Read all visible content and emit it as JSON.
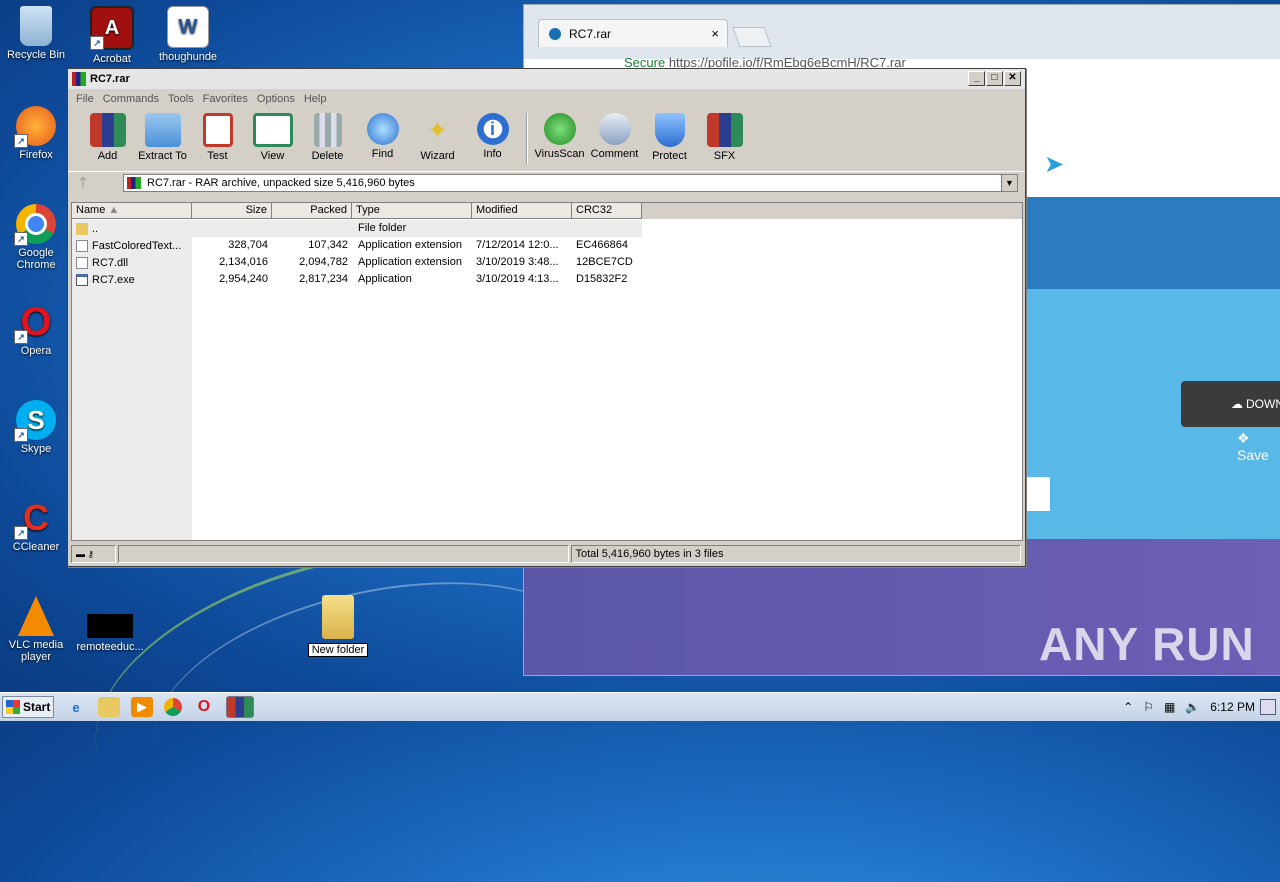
{
  "desktop": {
    "icons": [
      {
        "label": "Recycle Bin",
        "icon": "recycle-bin-icon"
      },
      {
        "label": "Acrobat",
        "icon": "acrobat-icon"
      },
      {
        "label": "thoughunde",
        "icon": "word-document-icon"
      },
      {
        "label": "Firefox",
        "icon": "firefox-icon"
      },
      {
        "label": "Google Chrome",
        "icon": "chrome-icon"
      },
      {
        "label": "Opera",
        "icon": "opera-icon"
      },
      {
        "label": "Skype",
        "icon": "skype-icon"
      },
      {
        "label": "CCleaner",
        "icon": "ccleaner-icon"
      },
      {
        "label": "VLC media player",
        "icon": "vlc-icon"
      },
      {
        "label": "remoteeduc...",
        "icon": "black-file-icon"
      }
    ],
    "new_folder_label": "New folder"
  },
  "browser": {
    "tab_title": "RC7.rar",
    "tab_close": "×",
    "address_secure": "Secure",
    "address_url": "https://pofile.io/f/RmEbq6eBcmH/RC7.rar",
    "download_label": "DOWN",
    "save_label": "Save",
    "watermark": "ANY RUN"
  },
  "winrar": {
    "title": "RC7.rar",
    "menu": [
      "File",
      "Commands",
      "Tools",
      "Favorites",
      "Options",
      "Help"
    ],
    "toolbar": [
      {
        "label": "Add",
        "icon": "add-archive-icon",
        "color": "#c0392b"
      },
      {
        "label": "Extract To",
        "icon": "extract-folder-icon",
        "color": "#4a90d9"
      },
      {
        "label": "Test",
        "icon": "test-clipboard-icon",
        "color": "#c0392b"
      },
      {
        "label": "View",
        "icon": "view-book-icon",
        "color": "#2e8b57"
      },
      {
        "label": "Delete",
        "icon": "trash-can-icon",
        "color": "#8899aa"
      },
      {
        "label": "Find",
        "icon": "magnifier-icon",
        "color": "#2c6fd1"
      },
      {
        "label": "Wizard",
        "icon": "magic-wand-icon",
        "color": "#e0c030"
      },
      {
        "label": "Info",
        "icon": "info-icon",
        "color": "#2c6fd1"
      },
      {
        "label": "VirusScan",
        "icon": "virus-bug-icon",
        "color": "#3aa83a"
      },
      {
        "label": "Comment",
        "icon": "comment-icon",
        "color": "#8aa0c0"
      },
      {
        "label": "Protect",
        "icon": "shield-icon",
        "color": "#2c6fd1"
      },
      {
        "label": "SFX",
        "icon": "sfx-books-icon",
        "color": "#c0392b"
      }
    ],
    "path_text": "RC7.rar - RAR archive, unpacked size 5,416,960 bytes",
    "columns": [
      "Name",
      "Size",
      "Packed",
      "Type",
      "Modified",
      "CRC32"
    ],
    "rows": [
      {
        "name": "..",
        "size": "",
        "packed": "",
        "type": "File folder",
        "modified": "",
        "crc": "",
        "icon": "folder-icon"
      },
      {
        "name": "FastColoredText...",
        "size": "328,704",
        "packed": "107,342",
        "type": "Application extension",
        "modified": "7/12/2014 12:0...",
        "crc": "EC466864",
        "icon": "dll-file-icon"
      },
      {
        "name": "RC7.dll",
        "size": "2,134,016",
        "packed": "2,094,782",
        "type": "Application extension",
        "modified": "3/10/2019 3:48...",
        "crc": "12BCE7CD",
        "icon": "dll-file-icon"
      },
      {
        "name": "RC7.exe",
        "size": "2,954,240",
        "packed": "2,817,234",
        "type": "Application",
        "modified": "3/10/2019 4:13...",
        "crc": "D15832F2",
        "icon": "exe-file-icon"
      }
    ],
    "status_total": "Total 5,416,960 bytes in 3 files"
  },
  "taskbar": {
    "start_label": "Start",
    "clock": "6:12 PM"
  }
}
